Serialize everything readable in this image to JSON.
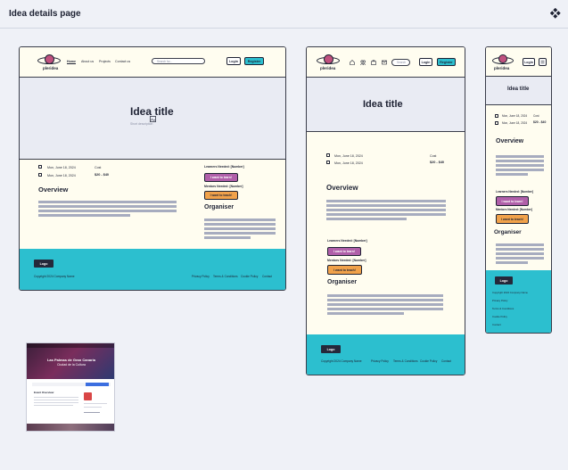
{
  "header": {
    "title": "Idea details page",
    "menu_icon": "diamond-grid-icon"
  },
  "brand": {
    "logo_text": "pleridea",
    "footer_logo": "Logo"
  },
  "nav": {
    "home": "Home",
    "about": "About us",
    "projects": "Projects",
    "contact": "Contact us",
    "search_placeholder": "Search for...",
    "search_short": "Search",
    "login": "Login",
    "register": "Register"
  },
  "idea": {
    "title": "Idea title",
    "short_description": "Short description",
    "start_date": "Mon, June 18, 2024",
    "end_date": "Mon, June 18, 2024",
    "cost_label": "Cost",
    "cost_range": "$20 - $40"
  },
  "overview": {
    "heading": "Overview"
  },
  "participation": {
    "learners_needed": "Learners Needed: [Number]",
    "join_learner": "I want to learn!",
    "mentors_needed": "Mentors Needed: [Number]",
    "join_mentor": "I want to teach!"
  },
  "organiser": {
    "heading": "Organiser"
  },
  "footer": {
    "copyright": "Copyright 2024 Company Name",
    "privacy": "Privacy Policy",
    "terms": "Terms & Conditions",
    "cookie": "Cookie Policy",
    "contact": "Contact"
  },
  "thumbnail": {
    "title": "Las Palmas de Gran Canaria",
    "subtitle": "Ciudad de la Cultura",
    "section": "Event Overview"
  },
  "colors": {
    "accent": "#2cbfcf",
    "learn_button": "#b05fa9",
    "teach_button": "#f1a24b",
    "logo_dot": "#c0517f",
    "page_bg": "#eff1f7",
    "frame_bg": "#fffdf0"
  }
}
